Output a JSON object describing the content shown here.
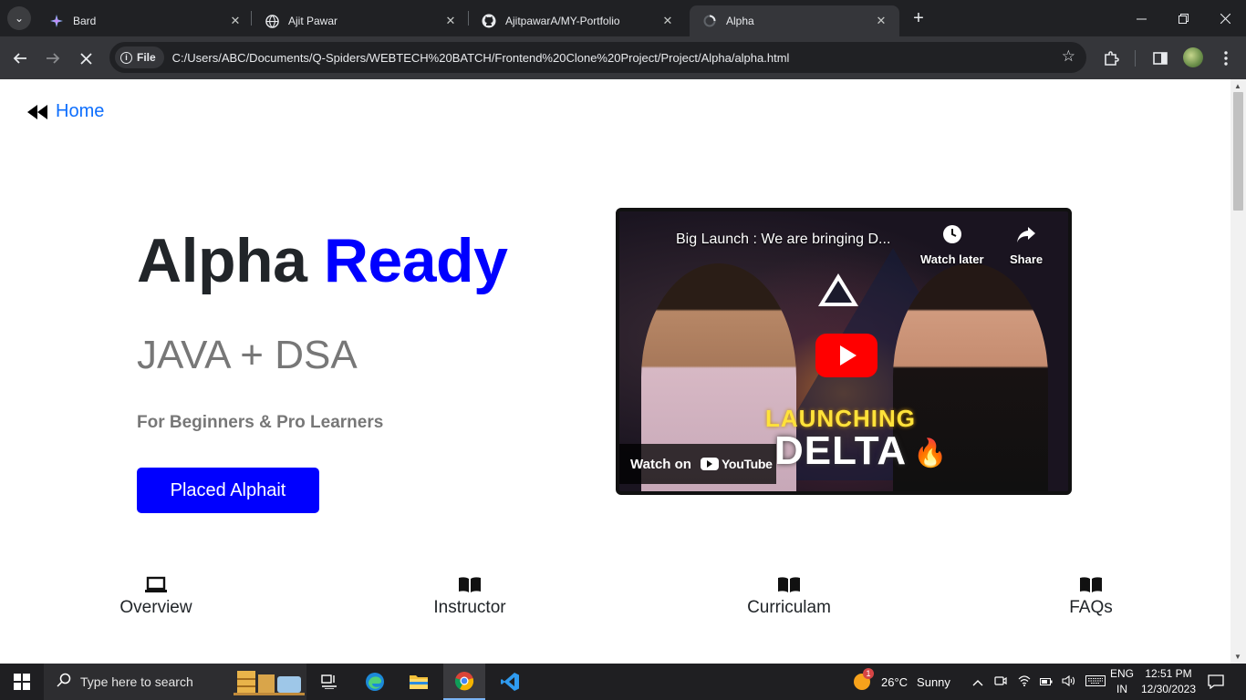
{
  "browser": {
    "tabs": [
      {
        "title": "Bard",
        "icon": "bard-icon",
        "active": false
      },
      {
        "title": "Ajit Pawar",
        "icon": "globe-icon",
        "active": false
      },
      {
        "title": "AjitpawarA/MY-Portfolio",
        "icon": "github-icon",
        "active": false
      },
      {
        "title": "Alpha",
        "icon": "loading-icon",
        "active": true
      }
    ],
    "address": {
      "chip_label": "File",
      "url": "C:/Users/ABC/Documents/Q-Spiders/WEBTECH%20BATCH/Frontend%20Clone%20Project/Project/Alpha/alpha.html"
    }
  },
  "page": {
    "home_link": "Home",
    "hero": {
      "title_main": "Alpha",
      "title_accent": "Ready",
      "subtitle": "JAVA + DSA",
      "tagline": "For Beginners & Pro Learners",
      "cta_label": "Placed Alphait"
    },
    "video": {
      "title": "Big Launch : We are bringing D...",
      "watch_later": "Watch later",
      "share": "Share",
      "overlay_line1": "LAUNCHING",
      "overlay_line2": "DELTA",
      "watch_on": "Watch on",
      "youtube": "YouTube"
    },
    "nav": [
      {
        "label": "Overview",
        "icon": "laptop-icon"
      },
      {
        "label": "Instructor",
        "icon": "book-icon"
      },
      {
        "label": "Curriculam",
        "icon": "book-icon"
      },
      {
        "label": "FAQs",
        "icon": "book-icon"
      }
    ]
  },
  "taskbar": {
    "search_placeholder": "Type here to search",
    "weather": {
      "temp": "26°C",
      "condition": "Sunny",
      "badge": "1"
    },
    "lang_line1": "ENG",
    "lang_line2": "IN",
    "time": "12:51 PM",
    "date": "12/30/2023"
  },
  "colors": {
    "accent_blue": "#0000ff",
    "link_blue": "#0d6efd",
    "chrome_dark": "#202124",
    "chrome_toolbar": "#35363a",
    "youtube_red": "#ff0000"
  }
}
